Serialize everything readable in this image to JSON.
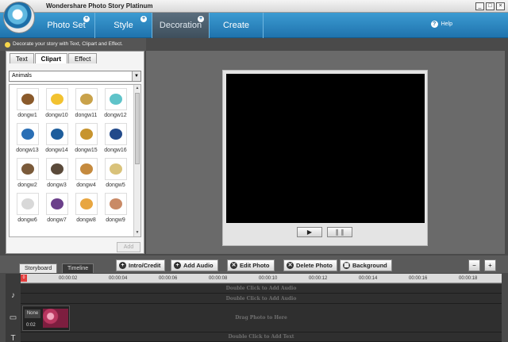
{
  "app": {
    "title": "Wondershare Photo Story Platinum"
  },
  "window_controls": [
    "_",
    "□",
    "×"
  ],
  "main_tabs": [
    {
      "label": "Photo Set",
      "has_plus": true,
      "active": false
    },
    {
      "label": "Style",
      "has_plus": true,
      "active": false
    },
    {
      "label": "Decoration",
      "has_plus": true,
      "active": true
    },
    {
      "label": "Create",
      "has_plus": false,
      "active": false
    }
  ],
  "help": {
    "label": "Help",
    "icon": "question-icon"
  },
  "tip": {
    "text": "Decorate your story with Text, Clipart and Effect.",
    "icon": "bulb-icon"
  },
  "decoration_panel": {
    "subtabs": [
      {
        "label": "Text",
        "active": false
      },
      {
        "label": "Clipart",
        "active": true
      },
      {
        "label": "Effect",
        "active": false
      }
    ],
    "category": {
      "selected": "Animals"
    },
    "cliparts": [
      {
        "label": "dongw1",
        "icon": "hedgehog-icon",
        "color": "#8a5a2b"
      },
      {
        "label": "dongw10",
        "icon": "chick-icon",
        "color": "#f2c230"
      },
      {
        "label": "dongw11",
        "icon": "dragonfly-icon",
        "color": "#c9a24a"
      },
      {
        "label": "dongw12",
        "icon": "seahorse-icon",
        "color": "#5fc3c9"
      },
      {
        "label": "dongw13",
        "icon": "butterfly-icon",
        "color": "#2a6fb5"
      },
      {
        "label": "dongw14",
        "icon": "butterfly-icon",
        "color": "#1f5e9c"
      },
      {
        "label": "dongw15",
        "icon": "dragonfly-icon",
        "color": "#c7942e"
      },
      {
        "label": "dongw16",
        "icon": "butterfly-icon",
        "color": "#234a8a"
      },
      {
        "label": "dongw2",
        "icon": "animal-icon",
        "color": "#7a5a3a"
      },
      {
        "label": "dongw3",
        "icon": "bird-icon",
        "color": "#5a4a3a"
      },
      {
        "label": "dongw4",
        "icon": "hamster-icon",
        "color": "#c58a3e"
      },
      {
        "label": "dongw5",
        "icon": "snail-icon",
        "color": "#d9c27a"
      },
      {
        "label": "dongw6",
        "icon": "goose-icon",
        "color": "#d8d8d8"
      },
      {
        "label": "dongw7",
        "icon": "bird-icon",
        "color": "#6b3f8a"
      },
      {
        "label": "dongw8",
        "icon": "chicken-icon",
        "color": "#e8a640"
      },
      {
        "label": "dongw9",
        "icon": "rabbit-icon",
        "color": "#c98a66"
      }
    ],
    "add_label": "Add"
  },
  "preview": {
    "play_symbol": "▶",
    "pause_symbol": "❚❚"
  },
  "bottom": {
    "tabs": [
      {
        "label": "Storyboard",
        "active": true
      },
      {
        "label": "Timeline",
        "active": false
      }
    ],
    "buttons": [
      {
        "label": "Intro/Credit",
        "icon": "plus-icon",
        "symbol": "+"
      },
      {
        "label": "Add Audio",
        "icon": "add-audio-icon",
        "symbol": "+"
      },
      {
        "label": "Edit Photo",
        "icon": "edit-icon",
        "symbol": "✕"
      },
      {
        "label": "Delete Photo",
        "icon": "delete-icon",
        "symbol": "✕"
      },
      {
        "label": "Background",
        "icon": "background-icon",
        "symbol": "▦"
      }
    ],
    "zoom_out": "−",
    "zoom_in": "+"
  },
  "timeline": {
    "ruler_ticks": [
      "00:00:02",
      "00:00:04",
      "00:00:06",
      "00:00:08",
      "00:00:10",
      "00:00:12",
      "00:00:14",
      "00:00:16",
      "00:00:18"
    ],
    "playhead_label": "0",
    "tracks": {
      "audio1": "Double Click to Add Audio",
      "audio2": "Double Click to Add Audio",
      "photo": "Drag Photo to Here",
      "text": "Double Click to Add Text"
    },
    "clip": {
      "transition": "None",
      "duration": "0:02"
    },
    "track_icons": {
      "audio": "♪",
      "photo": "▭",
      "text": "T"
    }
  }
}
